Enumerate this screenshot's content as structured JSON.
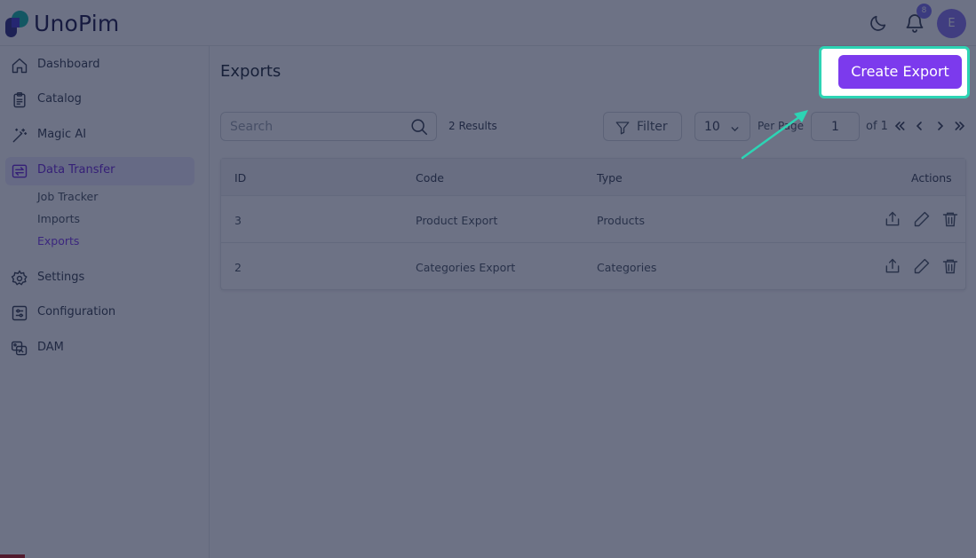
{
  "header": {
    "logo_text": "UnoPim",
    "notification_count": "8",
    "avatar_initial": "E"
  },
  "sidebar": {
    "items": [
      {
        "label": "Dashboard",
        "icon": "home-icon"
      },
      {
        "label": "Catalog",
        "icon": "clipboard-icon"
      },
      {
        "label": "Magic AI",
        "icon": "magic-wand-icon"
      },
      {
        "label": "Data Transfer",
        "icon": "data-transfer-icon"
      },
      {
        "label": "Settings",
        "icon": "gear-icon"
      },
      {
        "label": "Configuration",
        "icon": "sliders-icon"
      },
      {
        "label": "DAM",
        "icon": "dam-icon"
      }
    ],
    "sub_items": [
      "Job Tracker",
      "Imports",
      "Exports"
    ]
  },
  "main": {
    "title": "Exports",
    "create_button": "Create Export",
    "search_placeholder": "Search",
    "results_text": "2 Results",
    "filter_label": "Filter",
    "per_page_value": "10",
    "per_page_label": "Per Page",
    "current_page": "1",
    "of_pages": "of 1"
  },
  "table": {
    "columns": [
      "ID",
      "Code",
      "Type",
      "Actions"
    ],
    "rows": [
      {
        "id": "3",
        "code": "Product Export",
        "type": "Products"
      },
      {
        "id": "2",
        "code": "Categories Export",
        "type": "Categories"
      }
    ]
  },
  "colors": {
    "accent": "#7c3aed",
    "highlight": "#2dd4b4",
    "overlay": "#141c3a"
  }
}
